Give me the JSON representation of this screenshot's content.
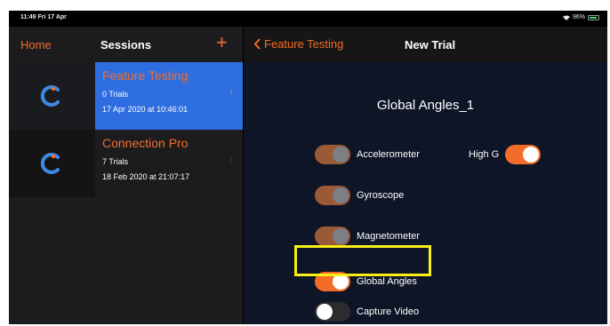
{
  "status_bar": {
    "time": "11:49 Fri 17 Apr",
    "battery_text": "96%"
  },
  "sessions_pane": {
    "home_label": "Home",
    "title": "Sessions",
    "add_label": "+",
    "items": [
      {
        "title": "Feature Testing",
        "trials": "0 Trials",
        "date": "17 Apr 2020 at 10:46:01",
        "selected": true
      },
      {
        "title": "Connection Pro",
        "trials": "7 Trials",
        "date": "18 Feb 2020 at 21:07:17",
        "selected": false
      }
    ]
  },
  "trial_pane": {
    "back_label": "Feature Testing",
    "title": "New Trial",
    "trial_name": "Global Angles_1",
    "options": {
      "accelerometer": {
        "label": "Accelerometer",
        "on": true
      },
      "high_g": {
        "label": "High G",
        "on": true
      },
      "gyroscope": {
        "label": "Gyroscope",
        "on": true
      },
      "magnetometer": {
        "label": "Magnetometer",
        "on": true
      },
      "global_angles": {
        "label": "Global Angles",
        "on": true
      },
      "capture_video": {
        "label": "Capture Video",
        "on": false
      }
    }
  },
  "colors": {
    "accent": "#f36d2a",
    "selection": "#2e6ee0",
    "highlight": "#f6ee14",
    "logo_blue": "#3d8be6"
  },
  "icons": [
    "wifi-icon",
    "battery-icon",
    "add-icon",
    "chevron-left-icon",
    "chevron-right-icon",
    "app-logo-icon"
  ]
}
